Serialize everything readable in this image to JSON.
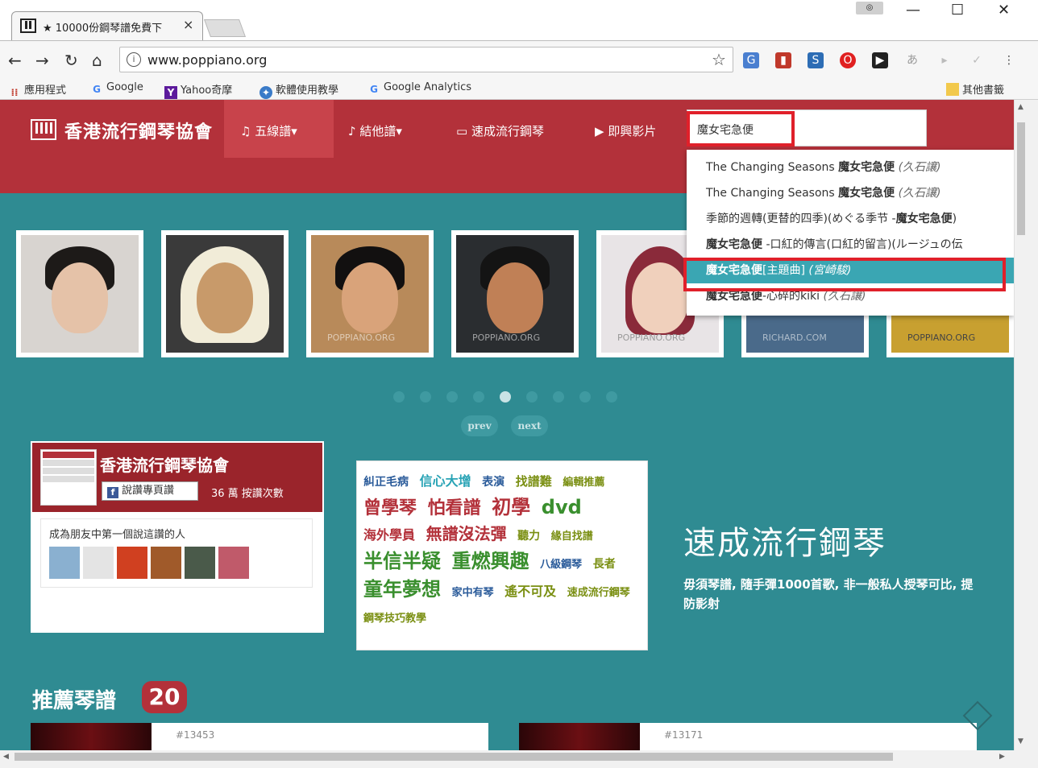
{
  "browser": {
    "tab_title": "★ 10000份鋼琴譜免費下",
    "tab_close": "×",
    "url": "www.poppiano.org",
    "window_controls": [
      "—",
      "☐",
      "✕"
    ],
    "bookmarks": [
      {
        "icon": "apps-grid-icon",
        "label": "應用程式"
      },
      {
        "icon": "google-icon",
        "label": "Google"
      },
      {
        "icon": "yahoo-icon",
        "label": "Yahoo奇摩"
      },
      {
        "icon": "software-icon",
        "label": "軟體使用教學"
      },
      {
        "icon": "google-icon",
        "label": "Google Analytics"
      },
      {
        "icon": "folder-icon",
        "label": "其他書籤"
      }
    ]
  },
  "site": {
    "logo_text": "香港流行鋼琴協會",
    "menu": [
      {
        "label": "五線譜▾",
        "icon": "music-note-icon"
      },
      {
        "label": "結他譜▾",
        "icon": "guitar-icon"
      },
      {
        "label": "速成流行鋼琴",
        "icon": "keyboard-icon"
      },
      {
        "label": "即興影片",
        "icon": "video-icon"
      }
    ],
    "search_value": "魔女宅急便",
    "autocomplete": [
      {
        "prefix": "The Changing Seasons ",
        "bold": "魔女宅急便",
        "suffix": " ",
        "artist": "(久石讓)"
      },
      {
        "prefix": "The Changing Seasons ",
        "bold": "魔女宅急便",
        "suffix": " ",
        "artist": "(久石讓)"
      },
      {
        "prefix": "季節的週轉(更替的四季)(めぐる季节 -",
        "bold": "魔女宅急便",
        "suffix": ")",
        "artist": ""
      },
      {
        "prefix": "",
        "bold": "魔女宅急便",
        "suffix": " -口紅的傳言(口紅的留言)(ルージュの伝",
        "artist": ""
      },
      {
        "prefix": "",
        "bold": "魔女宅急便",
        "suffix": "[主題曲] ",
        "artist": "(宮崎駿)"
      },
      {
        "prefix": "",
        "bold": "魔女宅急便",
        "suffix": "-心碎的kiki ",
        "artist": "(久石讓)"
      }
    ],
    "photo_watermarks": [
      "",
      "",
      "POPPIANO.ORG",
      "POPPIANO.ORG",
      "POPPIANO.ORG",
      "RICHARD.COM",
      "POPPIANO.ORG"
    ],
    "pager": {
      "prev": "prev",
      "next": "next",
      "active_index": 4
    },
    "fb": {
      "page_name": "香港流行鋼琴協會",
      "like_button": "說讚專頁讚",
      "likes": "36 萬 按讚次數",
      "friends_text": "成為朋友中第一個說這讚的人"
    },
    "tag_cloud": [
      {
        "t": "糾正毛病",
        "c": "blue",
        "s": 14
      },
      {
        "t": "信心大增",
        "c": "cyan",
        "s": 16
      },
      {
        "t": "表演",
        "c": "blue",
        "s": 14
      },
      {
        "t": "找譜難",
        "c": "olive",
        "s": 15
      },
      {
        "t": "編輯推薦",
        "c": "olive",
        "s": 13
      },
      {
        "t": "曾學琴",
        "c": "red",
        "s": 22
      },
      {
        "t": "怕看譜",
        "c": "red",
        "s": 22
      },
      {
        "t": "初學",
        "c": "red",
        "s": 24
      },
      {
        "t": "dvd",
        "c": "green",
        "s": 24
      },
      {
        "t": "海外學員",
        "c": "red",
        "s": 16
      },
      {
        "t": "無譜沒法彈",
        "c": "red",
        "s": 20
      },
      {
        "t": "聽力",
        "c": "olive",
        "s": 14
      },
      {
        "t": "緣自找譜",
        "c": "olive",
        "s": 13
      },
      {
        "t": "半信半疑",
        "c": "green",
        "s": 24
      },
      {
        "t": "重燃興趣",
        "c": "green",
        "s": 24
      },
      {
        "t": "八級鋼琴",
        "c": "blue",
        "s": 13
      },
      {
        "t": "長者",
        "c": "olive",
        "s": 14
      },
      {
        "t": "童年夢想",
        "c": "green",
        "s": 24
      },
      {
        "t": "家中有琴",
        "c": "blue",
        "s": 13
      },
      {
        "t": "遙不可及",
        "c": "olive",
        "s": 16
      },
      {
        "t": "速成流行鋼琴",
        "c": "olive",
        "s": 13
      },
      {
        "t": "鋼琴技巧教學",
        "c": "olive",
        "s": 13
      }
    ],
    "promo_title": "速成流行鋼琴",
    "promo_sub": "毋須琴譜, 隨手彈1000首歌, 非一般私人授琴可比, 提防影射",
    "rec_title": "推薦琴譜",
    "rec_count": "20",
    "cards": [
      {
        "num": "#13453"
      },
      {
        "num": "#13171"
      }
    ]
  },
  "colors": {
    "brand_red": "#b3313a",
    "teal": "#2f8b92",
    "highlight": "#3aa6b3",
    "frame": "#e0202a"
  }
}
